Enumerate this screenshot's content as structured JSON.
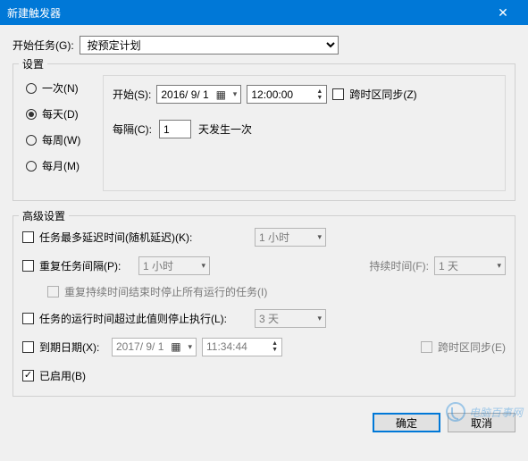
{
  "titlebar": {
    "title": "新建触发器",
    "close": "✕"
  },
  "begin": {
    "label": "开始任务(G):",
    "value": "按预定计划"
  },
  "settings": {
    "legend": "设置",
    "freq": {
      "once": "一次(N)",
      "daily": "每天(D)",
      "weekly": "每周(W)",
      "monthly": "每月(M)",
      "selected": "daily"
    },
    "start": {
      "label": "开始(S):",
      "date": "2016/ 9/ 1",
      "time": "12:00:00",
      "sync_label": "跨时区同步(Z)"
    },
    "interval": {
      "label": "每隔(C):",
      "value": "1",
      "unit": "天发生一次"
    }
  },
  "advanced": {
    "legend": "高级设置",
    "delay": {
      "label": "任务最多延迟时间(随机延迟)(K):",
      "value": "1 小时"
    },
    "repeat": {
      "label": "重复任务间隔(P):",
      "value": "1 小时",
      "duration_label": "持续时间(F):",
      "duration_value": "1 天"
    },
    "stop_after_repeat": "重复持续时间结束时停止所有运行的任务(I)",
    "stop_if": {
      "label": "任务的运行时间超过此值则停止执行(L):",
      "value": "3 天"
    },
    "expire": {
      "label": "到期日期(X):",
      "date": "2017/ 9/ 1",
      "time": "11:34:44",
      "sync_label": "跨时区同步(E)"
    },
    "enabled": "已启用(B)"
  },
  "buttons": {
    "ok": "确定",
    "cancel": "取消"
  },
  "watermark": "电脑百事网"
}
